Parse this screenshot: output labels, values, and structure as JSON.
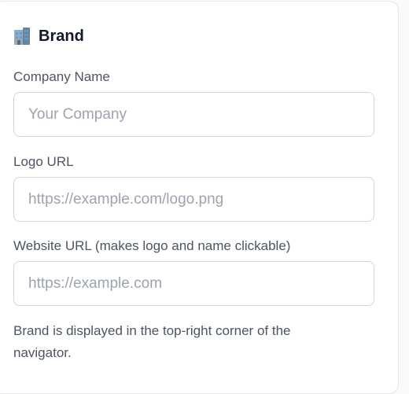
{
  "brand_section": {
    "title": "Brand",
    "icon": "office-building-icon",
    "fields": {
      "company_name": {
        "label": "Company Name",
        "placeholder": "Your Company",
        "value": ""
      },
      "logo_url": {
        "label": "Logo URL",
        "placeholder": "https://example.com/logo.png",
        "value": ""
      },
      "website_url": {
        "label": "Website URL (makes logo and name clickable)",
        "placeholder": "https://example.com",
        "value": ""
      }
    },
    "help_text": "Brand is displayed in the top-right corner of the navigator."
  },
  "colors": {
    "border": "#d1d5db",
    "label": "#4b5563",
    "placeholder": "#9ca3af",
    "title": "#111827"
  }
}
